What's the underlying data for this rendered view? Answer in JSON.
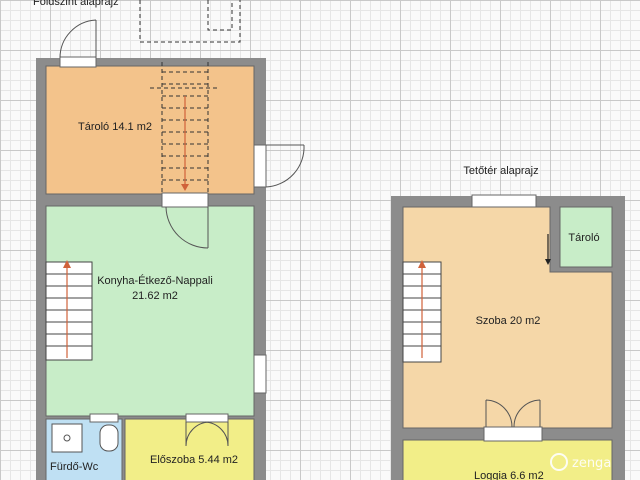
{
  "plans": {
    "ground_title": "Földszint alaprajz",
    "attic_title": "Tetőtér alaprajz"
  },
  "rooms": {
    "storage_ground": "Tároló 14.1 m2",
    "kitchen_line1": "Konyha-Étkező-Nappali",
    "kitchen_line2": "21.62 m2",
    "bathroom": "Fürdő-Wc",
    "hallway": "Előszoba 5.44 m2",
    "storage_attic": "Tároló",
    "bedroom": "Szoba 20 m2",
    "loggia": "Loggia 6.6 m2"
  },
  "watermark": {
    "brand": "zenga"
  },
  "colors": {
    "storage": "#f3c38b",
    "living": "#c8edc8",
    "bedroom": "#f5d7a8",
    "loggia": "#f2ee88",
    "wall": "#888888",
    "stair_arrow": "#d0623a"
  }
}
